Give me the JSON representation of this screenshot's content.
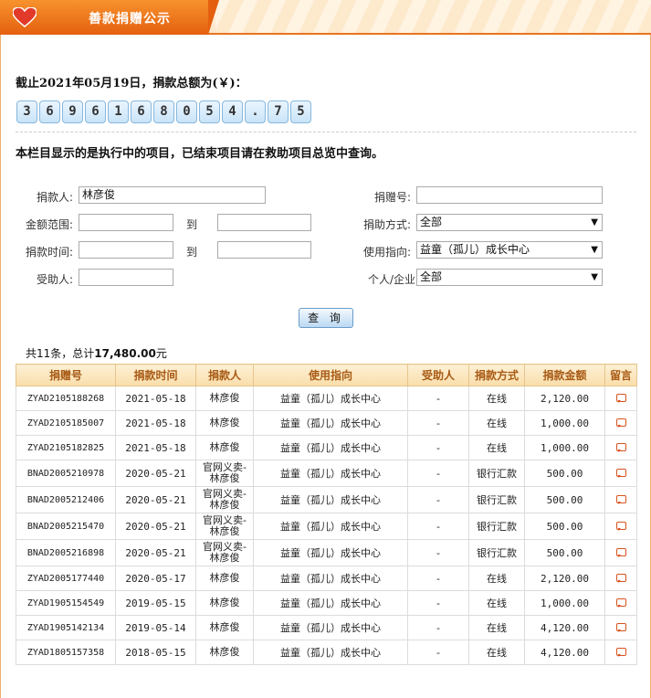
{
  "header": {
    "title": "善款捐赠公示"
  },
  "summary_total": {
    "label": "截止2021年05月19日，捐款总额为(￥)：",
    "digits": [
      "3",
      "6",
      "9",
      "6",
      "1",
      "6",
      "8",
      "0",
      "5",
      "4",
      ".",
      "7",
      "5"
    ]
  },
  "notice": "本栏目显示的是执行中的项目，已结束项目请在救助项目总览中查询。",
  "form": {
    "donor_label": "捐款人:",
    "donor_value": "林彦俊",
    "donation_no_label": "捐赠号:",
    "amount_label": "金额范围:",
    "to_label": "到",
    "method_label": "捐助方式:",
    "method_value": "全部",
    "time_label": "捐款时间:",
    "direction_label": "使用指向:",
    "direction_value": "益童（孤儿）成长中心",
    "recipient_label": "受助人:",
    "type_label": "个人/企业",
    "type_value": "全部",
    "query_button": "查 询"
  },
  "result_summary": {
    "prefix": "共11条，总计",
    "total": "17,480.00",
    "suffix": "元"
  },
  "table": {
    "headers": [
      "捐赠号",
      "捐款时间",
      "捐款人",
      "使用指向",
      "受助人",
      "捐款方式",
      "捐款金额",
      "留言"
    ],
    "rows": [
      {
        "id": "ZYAD2105188268",
        "date": "2021-05-18",
        "donor": "林彦俊",
        "direction": "益童（孤儿）成长中心",
        "recipient": "-",
        "method": "在线",
        "amount": "2,120.00"
      },
      {
        "id": "ZYAD2105185007",
        "date": "2021-05-18",
        "donor": "林彦俊",
        "direction": "益童（孤儿）成长中心",
        "recipient": "-",
        "method": "在线",
        "amount": "1,000.00"
      },
      {
        "id": "ZYAD2105182825",
        "date": "2021-05-18",
        "donor": "林彦俊",
        "direction": "益童（孤儿）成长中心",
        "recipient": "-",
        "method": "在线",
        "amount": "1,000.00"
      },
      {
        "id": "BNAD2005210978",
        "date": "2020-05-21",
        "donor": "官网义卖-林彦俊",
        "direction": "益童（孤儿）成长中心",
        "recipient": "-",
        "method": "银行汇款",
        "amount": "500.00"
      },
      {
        "id": "BNAD2005212406",
        "date": "2020-05-21",
        "donor": "官网义卖-林彦俊",
        "direction": "益童（孤儿）成长中心",
        "recipient": "-",
        "method": "银行汇款",
        "amount": "500.00"
      },
      {
        "id": "BNAD2005215470",
        "date": "2020-05-21",
        "donor": "官网义卖-林彦俊",
        "direction": "益童（孤儿）成长中心",
        "recipient": "-",
        "method": "银行汇款",
        "amount": "500.00"
      },
      {
        "id": "BNAD2005216898",
        "date": "2020-05-21",
        "donor": "官网义卖-林彦俊",
        "direction": "益童（孤儿）成长中心",
        "recipient": "-",
        "method": "银行汇款",
        "amount": "500.00"
      },
      {
        "id": "ZYAD2005177440",
        "date": "2020-05-17",
        "donor": "林彦俊",
        "direction": "益童（孤儿）成长中心",
        "recipient": "-",
        "method": "在线",
        "amount": "2,120.00"
      },
      {
        "id": "ZYAD1905154549",
        "date": "2019-05-15",
        "donor": "林彦俊",
        "direction": "益童（孤儿）成长中心",
        "recipient": "-",
        "method": "在线",
        "amount": "1,000.00"
      },
      {
        "id": "ZYAD1905142134",
        "date": "2019-05-14",
        "donor": "林彦俊",
        "direction": "益童（孤儿）成长中心",
        "recipient": "-",
        "method": "在线",
        "amount": "4,120.00"
      },
      {
        "id": "ZYAD1805157358",
        "date": "2018-05-15",
        "donor": "林彦俊",
        "direction": "益童（孤儿）成长中心",
        "recipient": "-",
        "method": "在线",
        "amount": "4,120.00"
      }
    ]
  },
  "icons": {
    "header": "heart-icon",
    "message": "message-icon",
    "dropdown": "chevron-down-icon"
  },
  "colors": {
    "accent": "#e8731f",
    "header_text": "#a85a14"
  }
}
